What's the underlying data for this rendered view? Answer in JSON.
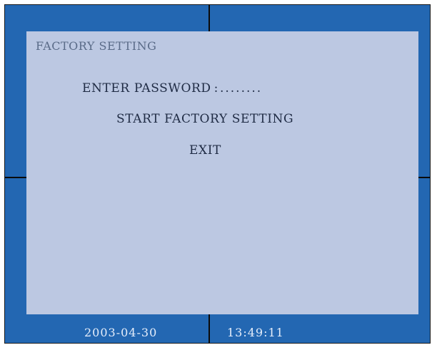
{
  "menu": {
    "title": "FACTORY SETTING",
    "items": {
      "password_label": "ENTER PASSWORD",
      "password_colon": ":",
      "password_value": "........",
      "start_factory_setting": "START FACTORY SETTING",
      "exit": "EXIT"
    }
  },
  "status_bar": {
    "date": "2003-04-30",
    "time": "13:49:11"
  },
  "colors": {
    "background_blue": "#2367b2",
    "menu_panel": "#bcc8e2",
    "menu_text": "#1f2b44",
    "title_text": "#5a6b88",
    "divider": "#0b0b0b",
    "status_text": "#e6eefb"
  }
}
